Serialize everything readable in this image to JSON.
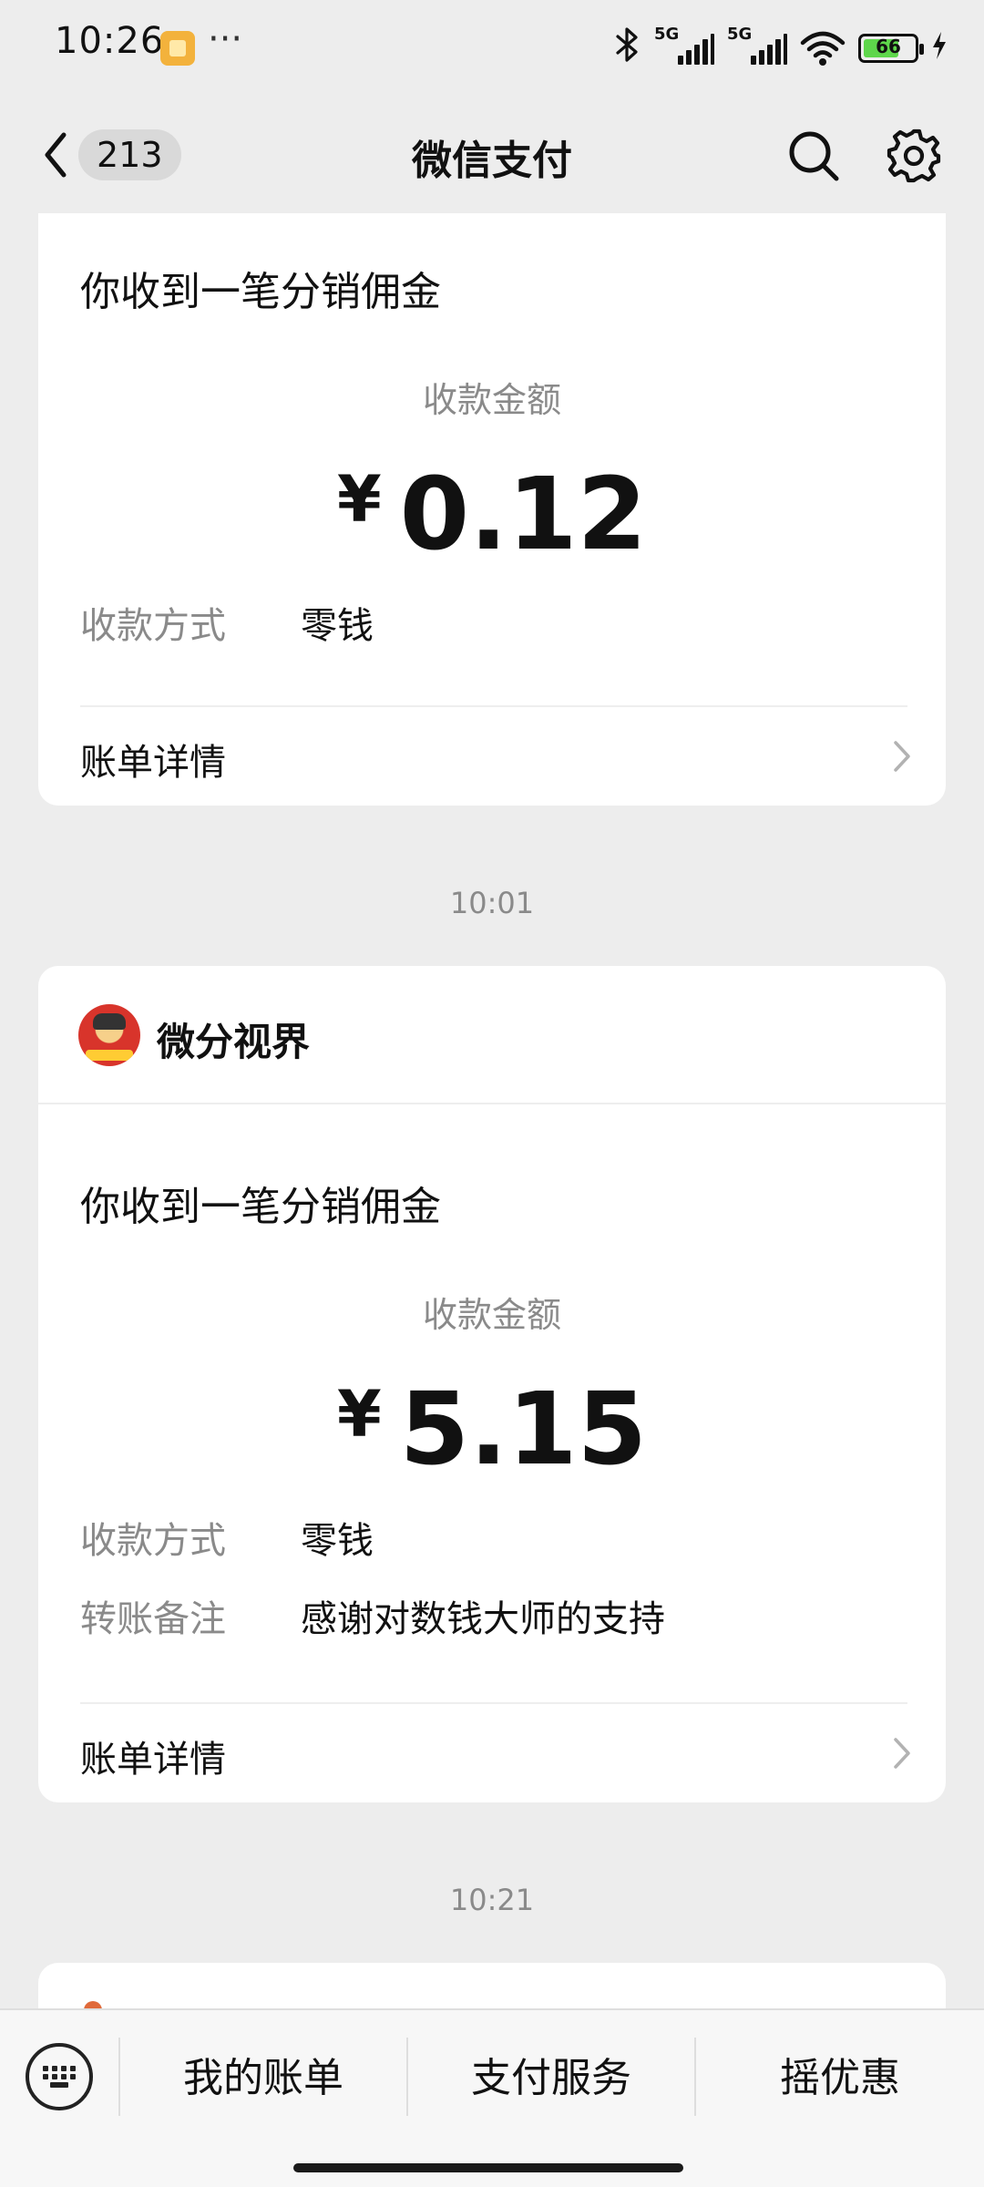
{
  "status_bar": {
    "time": "10:26",
    "more": "···",
    "signal1_label": "5G",
    "signal2_label": "5G",
    "battery_level": "66"
  },
  "nav": {
    "badge_count": "213",
    "title": "微信支付"
  },
  "cards": [
    {
      "title": "你收到一笔分销佣金",
      "amount_label": "收款金额",
      "currency": "¥",
      "amount": "0.12",
      "rows": [
        {
          "label": "收款方式",
          "value": "零钱"
        }
      ],
      "detail_label": "账单详情"
    },
    {
      "merchant": "微分视界",
      "title": "你收到一笔分销佣金",
      "amount_label": "收款金额",
      "currency": "¥",
      "amount": "5.15",
      "rows": [
        {
          "label": "收款方式",
          "value": "零钱"
        },
        {
          "label": "转账备注",
          "value": "感谢对数钱大师的支持"
        }
      ],
      "detail_label": "账单详情"
    }
  ],
  "timestamps": [
    "10:01",
    "10:21"
  ],
  "bottom_menu": {
    "items": [
      "我的账单",
      "支付服务",
      "摇优惠"
    ]
  },
  "colors": {
    "background": "#ededed",
    "card": "#ffffff",
    "secondary_text": "#8a8a8a",
    "battery_fill": "#5ed64b"
  }
}
